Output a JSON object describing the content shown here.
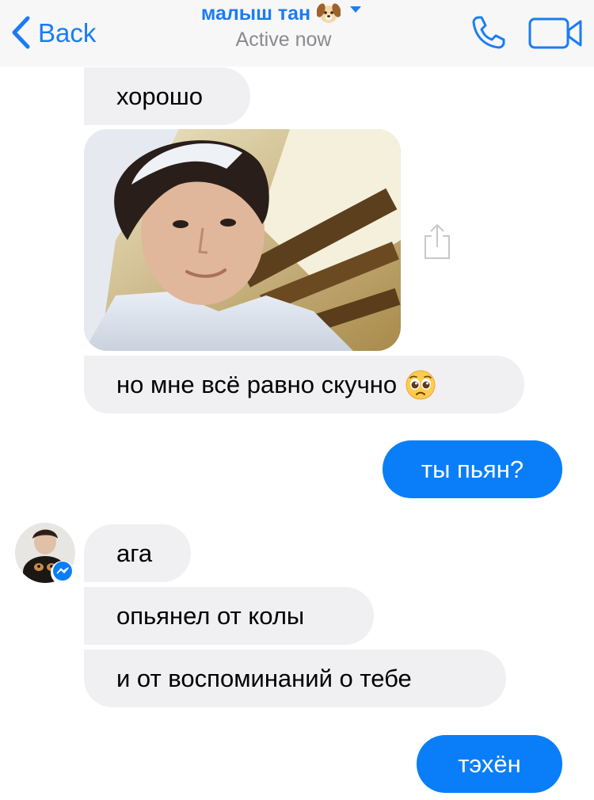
{
  "header": {
    "back_label": "Back",
    "title": "малыш тан",
    "title_emoji": "dog-face-emoji",
    "subtitle": "Active now",
    "phone_icon": "phone-icon",
    "video_icon": "video-camera-icon"
  },
  "colors": {
    "accent": "#1a7cf5",
    "outgoing_bubble": "#0a7ef8",
    "incoming_bubble": "#f0f0f3",
    "header_bg": "#f7f7f8",
    "subtitle_gray": "#8a8a8e"
  },
  "messages": [
    {
      "direction": "in",
      "type": "text",
      "text": "хорошо"
    },
    {
      "direction": "in",
      "type": "photo",
      "share_icon": "share-icon"
    },
    {
      "direction": "in",
      "type": "text",
      "text": "но мне всё равно скучно",
      "emoji": "pleading-face-emoji"
    },
    {
      "direction": "out",
      "type": "text",
      "text": "ты пьян?"
    },
    {
      "direction": "in",
      "type": "text",
      "text": "ага"
    },
    {
      "direction": "in",
      "type": "text",
      "text": "опьянел от колы"
    },
    {
      "direction": "in",
      "type": "text",
      "text": "и от воспоминаний о тебе"
    },
    {
      "direction": "out",
      "type": "text",
      "text": "тэхён"
    }
  ]
}
